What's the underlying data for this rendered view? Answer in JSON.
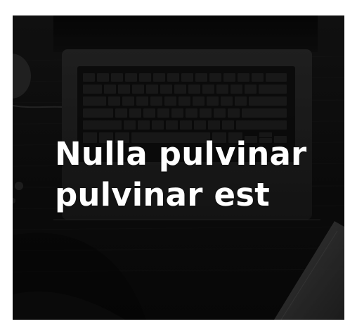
{
  "hero": {
    "title": "Nulla pulvinar pulvinar est",
    "icon": "laptop-photo",
    "accent_colors": {
      "background": "#121212",
      "text": "#ffffff"
    }
  }
}
